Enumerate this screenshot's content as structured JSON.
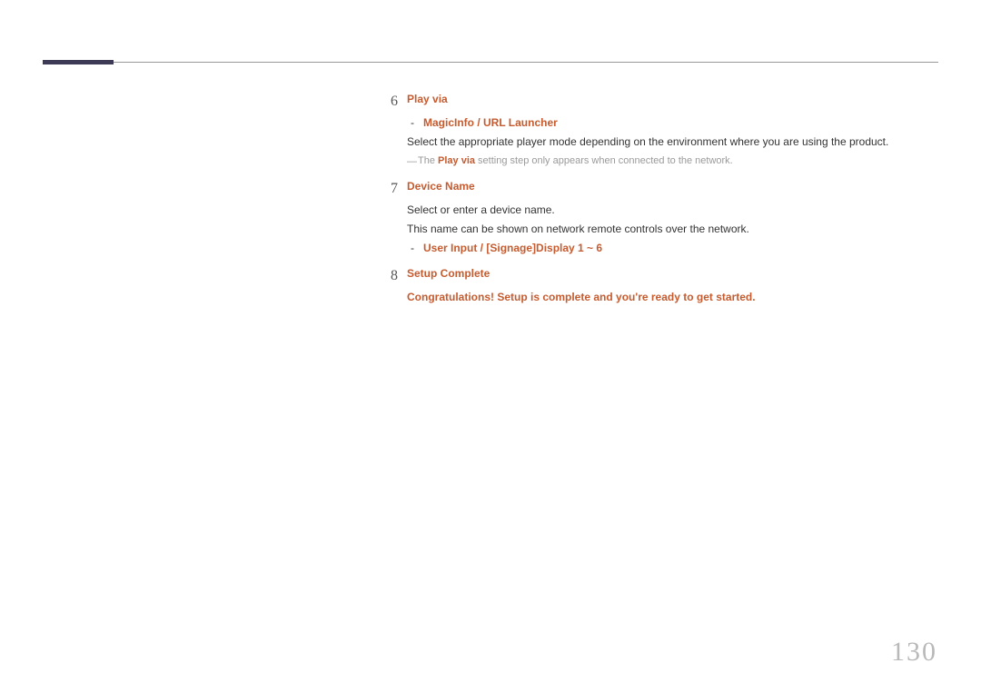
{
  "page_number": "130",
  "steps": [
    {
      "num": "6",
      "title": "Play via",
      "options": "MagicInfo / URL Launcher",
      "desc": "Select the appropriate player mode depending on the environment where you are using the product.",
      "note_prefix": "The ",
      "note_bold": "Play via",
      "note_suffix": " setting step only appears when connected to the network."
    },
    {
      "num": "7",
      "title": "Device Name",
      "line1": "Select or enter a device name.",
      "line2": "This name can be shown on network remote controls over the network.",
      "option_a": "User Input",
      "option_slash": " / ",
      "option_b": "[Signage]Display 1 ~ 6"
    },
    {
      "num": "8",
      "title": "Setup Complete",
      "congrats": "Congratulations! Setup is complete and you're ready to get started."
    }
  ]
}
